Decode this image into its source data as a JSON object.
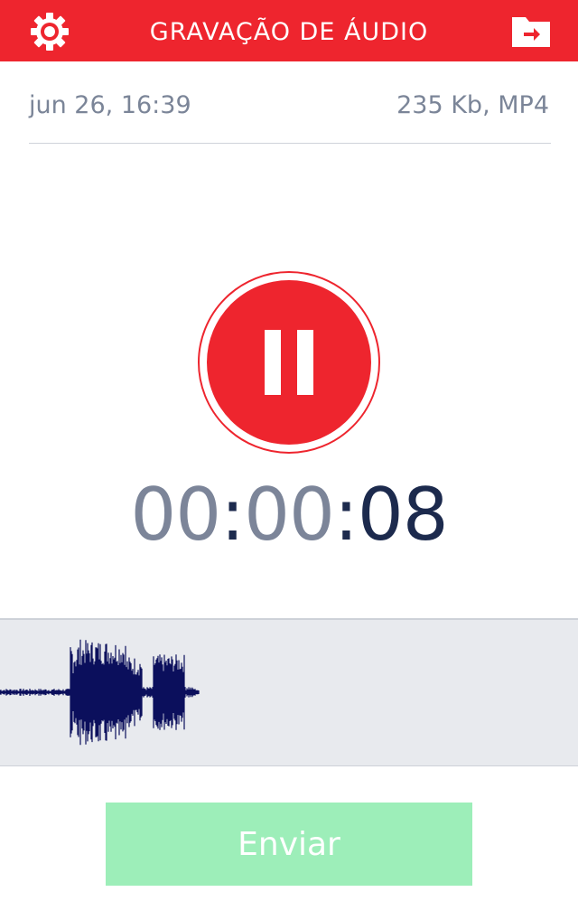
{
  "header": {
    "title": "GRAVAÇÃO DE ÁUDIO",
    "settings_icon": "gear-icon",
    "folder_icon": "folder-export-icon",
    "color": "#ee252e"
  },
  "recording": {
    "date": "jun 26, 16:39",
    "file_info": "235 Kb, MP4",
    "state": "recording",
    "pause_icon": "pause-icon"
  },
  "timer": {
    "hours": "00",
    "minutes": "00",
    "seconds": "08",
    "separator": ":"
  },
  "waveform": {
    "color": "#0b0f5c"
  },
  "send_button": {
    "label": "Enviar",
    "color": "#9deeb9",
    "enabled": false
  }
}
